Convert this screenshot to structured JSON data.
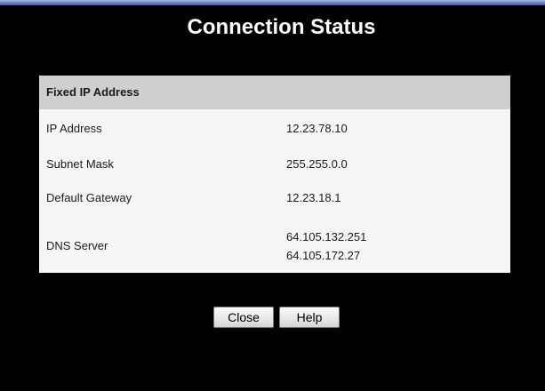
{
  "page": {
    "title": "Connection Status"
  },
  "status": {
    "section_title": "Fixed IP Address",
    "rows": [
      {
        "label": "IP Address",
        "value": "12.23.78.10"
      },
      {
        "label": "Subnet Mask",
        "value": "255.255.0.0"
      },
      {
        "label": "Default Gateway",
        "value": "12.23.18.1"
      },
      {
        "label": "DNS Server",
        "values": [
          "64.105.132.251",
          "64.105.172.27"
        ]
      }
    ]
  },
  "buttons": {
    "close_label": "Close",
    "help_label": "Help"
  },
  "colors": {
    "background": "#000000",
    "panel": "#f6f6f6",
    "header": "#cfcfcf",
    "title_text": "#ffffff"
  }
}
